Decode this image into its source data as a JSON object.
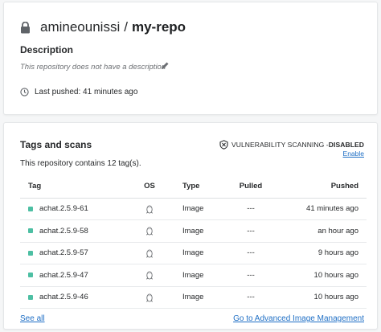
{
  "repo": {
    "owner": "amineounissi",
    "separator": "/",
    "name": "my-repo",
    "description_label": "Description",
    "description_text": "This repository does not have a description",
    "last_pushed": "Last pushed: 41 minutes ago"
  },
  "tags": {
    "title": "Tags and scans",
    "vuln_label": "VULNERABILITY SCANNING - ",
    "vuln_status": "DISABLED",
    "enable_link": "Enable",
    "count_text": "This repository contains 12 tag(s).",
    "columns": {
      "tag": "Tag",
      "os": "OS",
      "type": "Type",
      "pulled": "Pulled",
      "pushed": "Pushed"
    },
    "rows": [
      {
        "tag": "achat.2.5.9-61",
        "type": "Image",
        "pulled": "---",
        "pushed": "41 minutes ago"
      },
      {
        "tag": "achat.2.5.9-58",
        "type": "Image",
        "pulled": "---",
        "pushed": "an hour ago"
      },
      {
        "tag": "achat.2.5.9-57",
        "type": "Image",
        "pulled": "---",
        "pushed": "9 hours ago"
      },
      {
        "tag": "achat.2.5.9-47",
        "type": "Image",
        "pulled": "---",
        "pushed": "10 hours ago"
      },
      {
        "tag": "achat.2.5.9-46",
        "type": "Image",
        "pulled": "---",
        "pushed": "10 hours ago"
      }
    ],
    "see_all": "See all",
    "advanced_link": "Go to Advanced Image Management"
  },
  "icons": {
    "lock": "lock-icon",
    "edit": "pencil-icon",
    "clock": "clock-icon",
    "shield": "shield-icon",
    "os": "linux-icon"
  },
  "colors": {
    "link": "#1f6fc5",
    "tag_dot": "#4dbfa3"
  }
}
